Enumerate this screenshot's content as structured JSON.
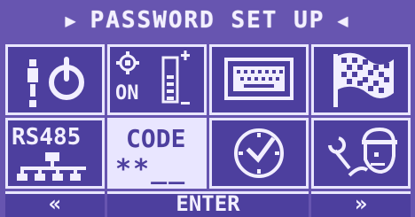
{
  "header": {
    "title": "PASSWORD SET UP",
    "left_arrow_icon": "triangle-right-icon",
    "right_arrow_icon": "triangle-left-icon"
  },
  "tiles": [
    {
      "id": "power",
      "icon": "power-icon"
    },
    {
      "id": "display",
      "label": "ON",
      "icon": "brightness-icon"
    },
    {
      "id": "keyboard",
      "icon": "keyboard-icon"
    },
    {
      "id": "flag",
      "icon": "checkered-flag-icon"
    },
    {
      "id": "rs485",
      "label": "RS485",
      "icon": "network-icon"
    },
    {
      "id": "code",
      "label": "CODE",
      "value": "**__",
      "selected": true
    },
    {
      "id": "clock",
      "icon": "clock-icon"
    },
    {
      "id": "service",
      "icon": "wrench-technician-icon"
    }
  ],
  "footer": {
    "prev": "«",
    "enter": "ENTER",
    "next": "»"
  },
  "colors": {
    "background": "#6755b0",
    "tile": "#4d3f9e",
    "line": "#e9e6ff"
  }
}
